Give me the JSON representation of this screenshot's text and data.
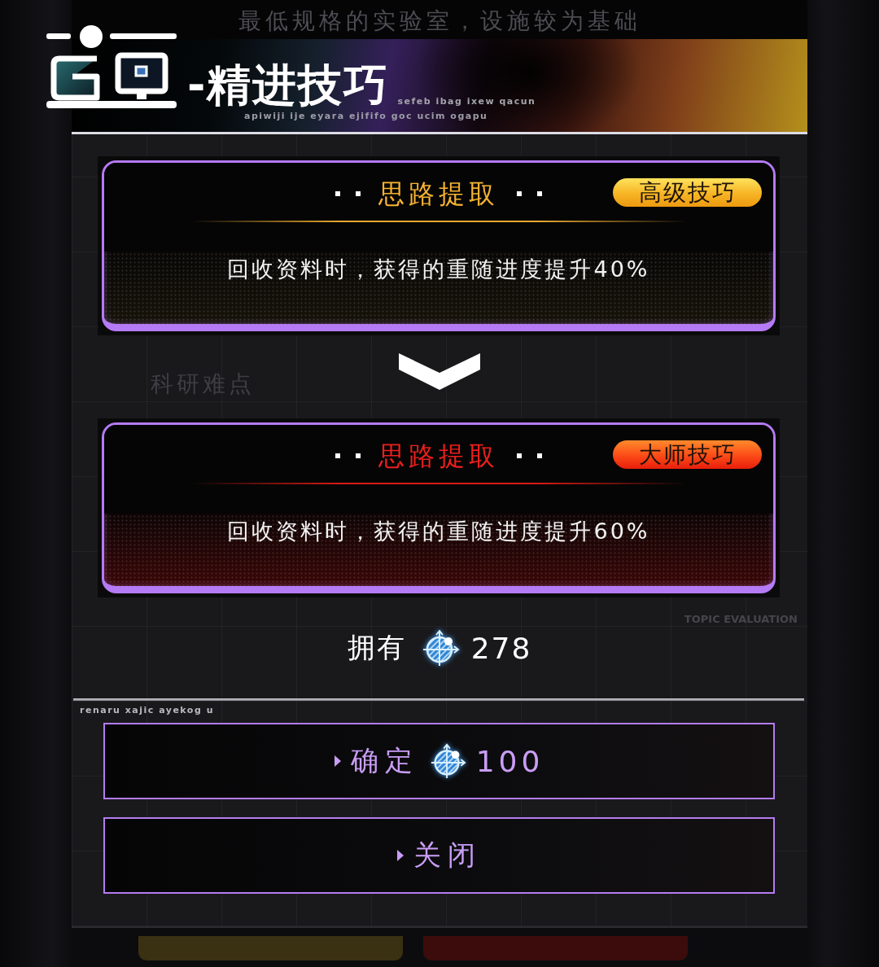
{
  "background_page": {
    "header_text": "最低规格的实验室，设施较为基础",
    "section_label": "科研难点",
    "section_tag": "TOPIC EVALUATION"
  },
  "header": {
    "title": "-精进技巧",
    "subtitle": "sefeb ibag ixew qacun",
    "caption": "apiwiji ije eyara ejififo goc ucim ogapu"
  },
  "skills": [
    {
      "kind": "advanced",
      "name": "思路提取",
      "badge": "高级技巧",
      "description": "回收资料时，获得的重随进度提升40%"
    },
    {
      "kind": "master",
      "name": "思路提取",
      "badge": "大师技巧",
      "description": "回收资料时，获得的重随进度提升60%"
    }
  ],
  "owned": {
    "label": "拥有",
    "amount": "278"
  },
  "footer_caption": "renaru xajic ayekog u",
  "buttons": [
    {
      "kind": "confirm",
      "label": "确定",
      "cost": "100"
    },
    {
      "kind": "close",
      "label": "关闭"
    }
  ]
}
